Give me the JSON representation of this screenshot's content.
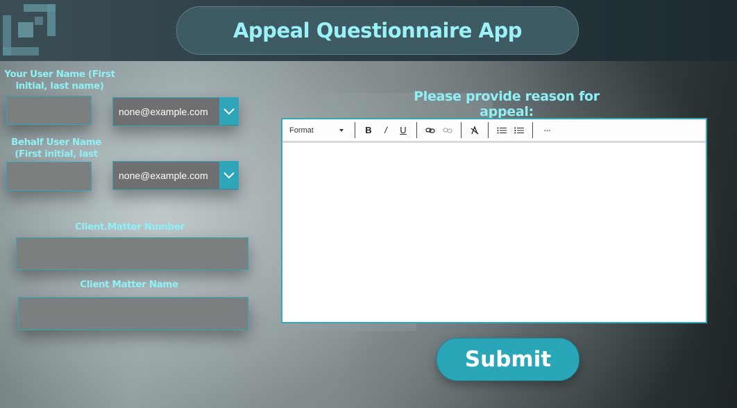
{
  "app": {
    "title": "Appeal Questionnaire App"
  },
  "form": {
    "user_name_label": "Your User Name (First initial, last name)",
    "user_name_value": "",
    "user_email_dropdown": "none@example.com",
    "behalf_label": "Behalf User Name (First initial, last name)",
    "behalf_name_value": "",
    "behalf_email_dropdown": "none@example.com",
    "client_matter_number_label": "Client.Matter Number",
    "client_matter_number_value": "",
    "client_matter_name_label": "Client Matter Name",
    "client_matter_name_value": ""
  },
  "reason": {
    "label": "Please provide reason for appeal:",
    "toolbar": {
      "format_label": "Format",
      "bold": "B",
      "italic": "/",
      "underline": "U",
      "more": "···"
    },
    "text": ""
  },
  "submit_label": "Submit",
  "colors": {
    "accent": "#2aa6b9",
    "label": "#8ff0f6",
    "header": "#2c3e44"
  }
}
